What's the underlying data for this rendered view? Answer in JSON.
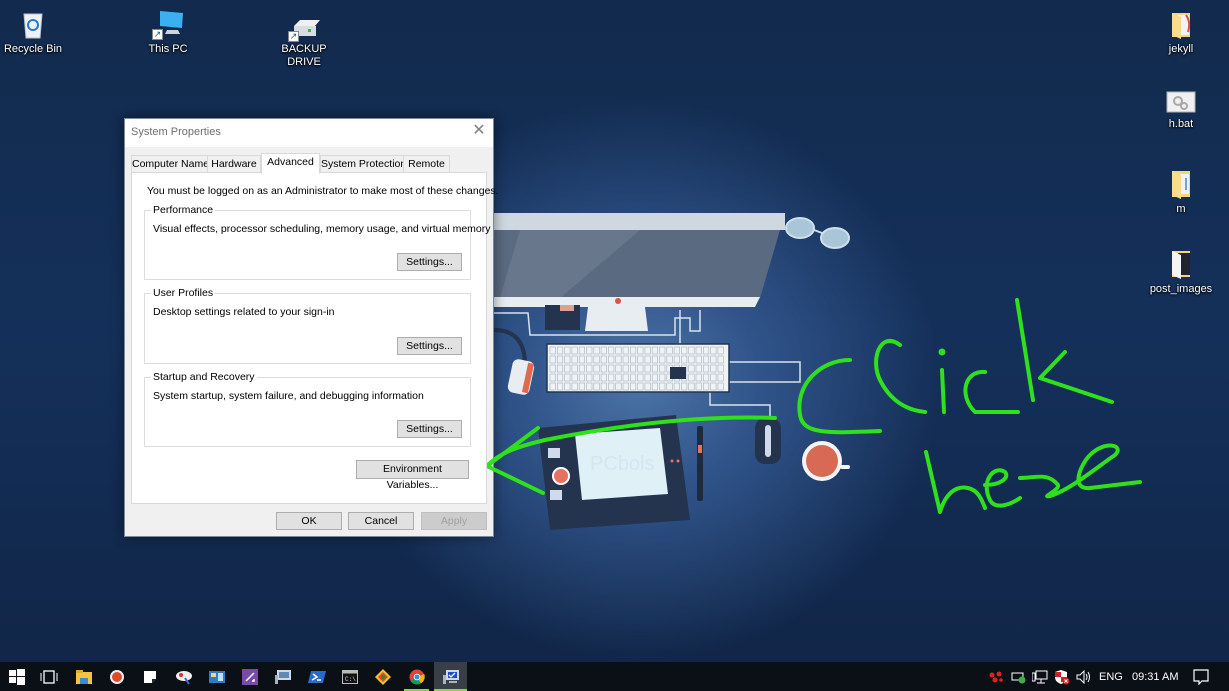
{
  "desktop": {
    "icons_left": [
      {
        "label": "Recycle Bin",
        "icon": "recycle-bin-icon"
      },
      {
        "label": "This PC",
        "icon": "computer-icon",
        "shortcut": true
      },
      {
        "label": "BACKUP DRIVE",
        "label_line1": "BACKUP",
        "label_line2": "DRIVE",
        "icon": "drive-icon",
        "shortcut": true
      }
    ],
    "icons_right": [
      {
        "label": "jekyll",
        "icon": "folder-icon"
      },
      {
        "label": "h.bat",
        "icon": "batch-file-icon"
      },
      {
        "label": "m",
        "icon": "folder-icon"
      },
      {
        "label": "post_images",
        "icon": "folder-icon"
      }
    ],
    "wallpaper_watermark": "PCbols"
  },
  "dialog": {
    "title": "System Properties",
    "close_glyph": "✕",
    "tabs": [
      {
        "label": "Computer Name",
        "active": false
      },
      {
        "label": "Hardware",
        "active": false
      },
      {
        "label": "Advanced",
        "active": true
      },
      {
        "label": "System Protection",
        "active": false
      },
      {
        "label": "Remote",
        "active": false
      }
    ],
    "admin_note": "You must be logged on as an Administrator to make most of these changes.",
    "groups": [
      {
        "label": "Performance",
        "description": "Visual effects, processor scheduling, memory usage, and virtual memory",
        "button": "Settings..."
      },
      {
        "label": "User Profiles",
        "description": "Desktop settings related to your sign-in",
        "button": "Settings..."
      },
      {
        "label": "Startup and Recovery",
        "description": "System startup, system failure, and debugging information",
        "button": "Settings..."
      }
    ],
    "env_button": "Environment Variables...",
    "ok": "OK",
    "cancel": "Cancel",
    "apply": "Apply",
    "apply_enabled": false
  },
  "annotation": {
    "text_line1": "Click",
    "text_line2": "here",
    "color": "#2fe01c"
  },
  "taskbar": {
    "apps": [
      {
        "name": "start",
        "icon": "windows-logo-icon"
      },
      {
        "name": "task-view",
        "icon": "task-view-icon"
      },
      {
        "name": "file-explorer",
        "icon": "folder-icon"
      },
      {
        "name": "recorder",
        "icon": "record-icon"
      },
      {
        "name": "notes",
        "icon": "sticky-note-icon"
      },
      {
        "name": "paint",
        "icon": "paint-icon"
      },
      {
        "name": "control-panel",
        "icon": "control-panel-icon"
      },
      {
        "name": "visual-studio",
        "icon": "visual-studio-icon"
      },
      {
        "name": "remote-desktop",
        "icon": "remote-desktop-icon"
      },
      {
        "name": "powershell",
        "icon": "powershell-icon"
      },
      {
        "name": "command-prompt",
        "icon": "cmd-icon"
      },
      {
        "name": "git",
        "icon": "git-icon"
      },
      {
        "name": "chrome",
        "icon": "chrome-icon",
        "running": true
      },
      {
        "name": "system-properties",
        "icon": "system-properties-icon",
        "running": true,
        "active": true
      }
    ],
    "tray": {
      "language": "ENG",
      "time": "09:31 AM"
    }
  }
}
